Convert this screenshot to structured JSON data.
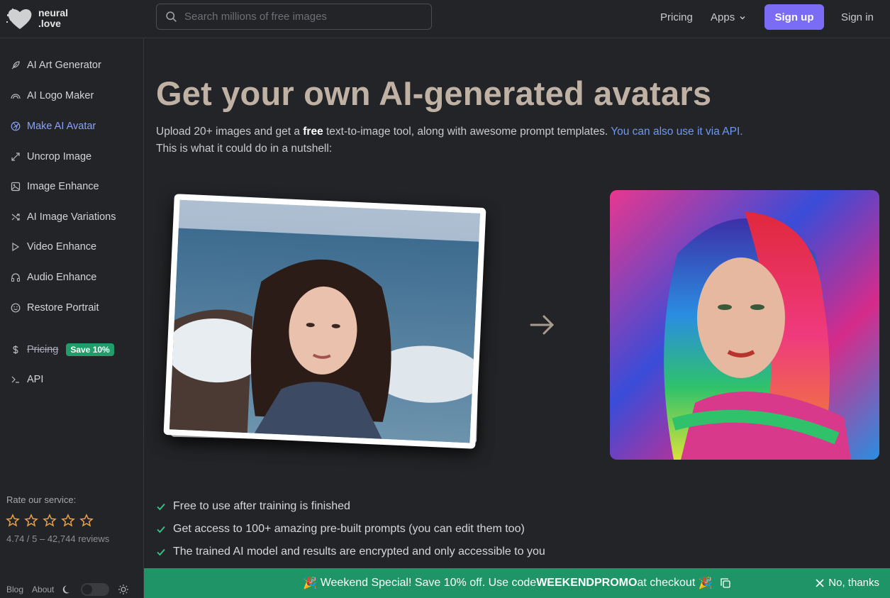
{
  "header": {
    "logo_line1": "neural",
    "logo_line2": ".love",
    "search_placeholder": "Search millions of free images",
    "nav": {
      "pricing": "Pricing",
      "apps": "Apps",
      "signup": "Sign up",
      "signin": "Sign in"
    }
  },
  "sidebar": {
    "items": [
      {
        "label": "AI Art Generator",
        "icon": "feather-icon"
      },
      {
        "label": "AI Logo Maker",
        "icon": "rainbow-icon"
      },
      {
        "label": "Make AI Avatar",
        "icon": "aperture-icon",
        "active": true
      },
      {
        "label": "Uncrop Image",
        "icon": "expand-icon"
      },
      {
        "label": "Image Enhance",
        "icon": "image-icon"
      },
      {
        "label": "AI Image Variations",
        "icon": "shuffle-icon"
      },
      {
        "label": "Video Enhance",
        "icon": "play-icon"
      },
      {
        "label": "Audio Enhance",
        "icon": "headphones-icon"
      },
      {
        "label": "Restore Portrait",
        "icon": "smile-icon"
      },
      {
        "label": "Pricing",
        "icon": "dollar-icon",
        "badge": "Save 10%"
      },
      {
        "label": "API",
        "icon": "terminal-icon"
      }
    ],
    "rate_label": "Rate our service:",
    "rating_text": "4.74 / 5 – 42,744 reviews",
    "footer": {
      "blog": "Blog",
      "about": "About"
    }
  },
  "main": {
    "title": "Get your own AI-generated avatars",
    "intro_before": "Upload 20+ images and get a ",
    "intro_bold": "free",
    "intro_after": " text-to-image tool, along with awesome prompt templates. ",
    "intro_link": "You can also use it via API.",
    "intro_line2": "This is what it could do in a nutshell:",
    "features": [
      "Free to use after training is finished",
      "Get access to 100+ amazing pre-built prompts (you can edit them too)",
      "The trained AI model and results are encrypted and only accessible to you"
    ]
  },
  "promo": {
    "text_before": "Weekend Special! Save 10% off. Use code ",
    "code": "WEEKENDPROMO",
    "text_after": " at checkout",
    "dismiss": "No, thanks"
  },
  "colors": {
    "accent": "#7b6cf6",
    "title": "#bfb1a4",
    "promo": "#1e9467",
    "link": "#6f97f5"
  }
}
